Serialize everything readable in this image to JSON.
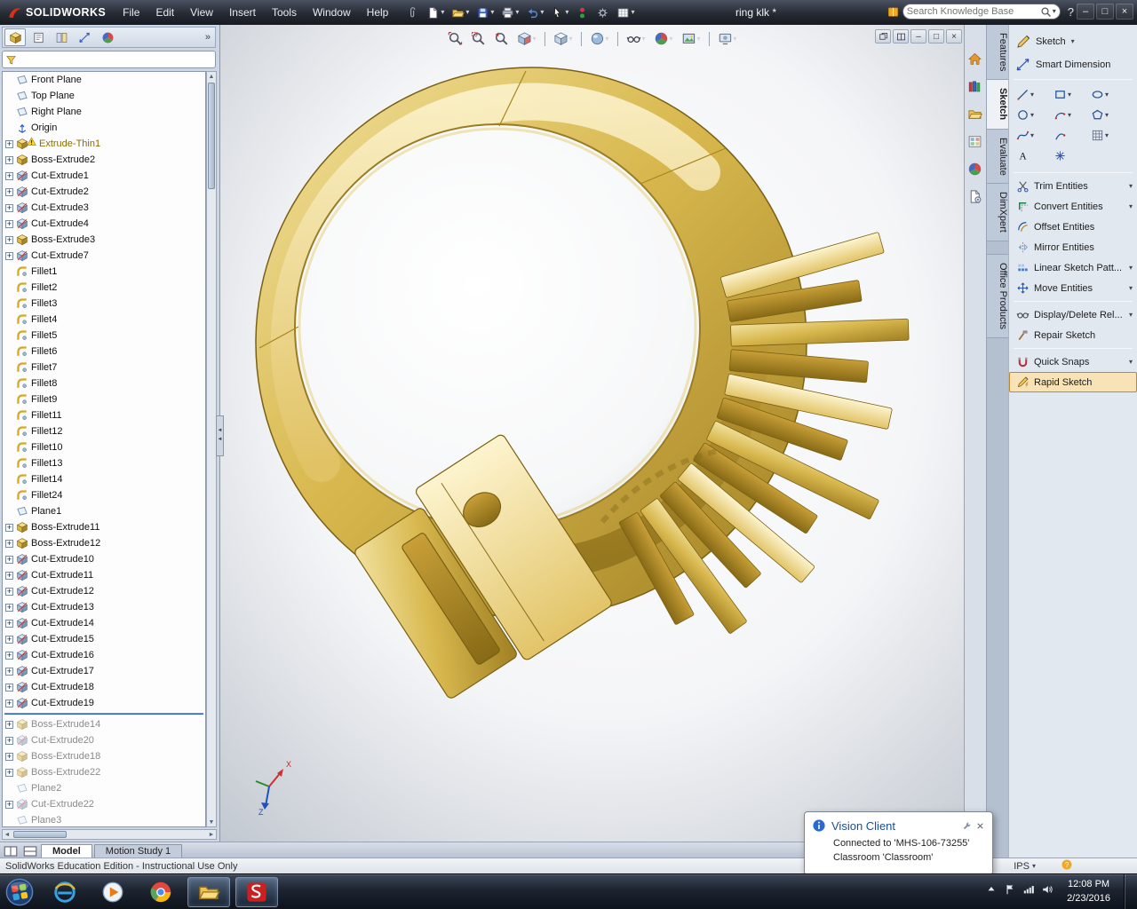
{
  "title_bar": {
    "app_name": "SOLIDWORKS",
    "menus": [
      "File",
      "Edit",
      "View",
      "Insert",
      "Tools",
      "Window",
      "Help"
    ],
    "toolbar": [
      {
        "name": "attach",
        "caret": false
      },
      {
        "name": "new-document",
        "caret": true
      },
      {
        "name": "open",
        "caret": true
      },
      {
        "name": "save",
        "caret": true
      },
      {
        "name": "print",
        "caret": true
      },
      {
        "name": "undo",
        "caret": true
      },
      {
        "name": "select",
        "caret": true
      },
      {
        "name": "stoplight",
        "caret": false
      },
      {
        "name": "options",
        "caret": false
      },
      {
        "name": "sheet",
        "caret": true
      }
    ],
    "document_name": "ring klk *",
    "search_placeholder": "Search Knowledge Base",
    "help_glyph": "?",
    "window_buttons": [
      {
        "name": "minimize",
        "glyph": "–"
      },
      {
        "name": "restore",
        "glyph": "□"
      },
      {
        "name": "close",
        "glyph": "×"
      }
    ]
  },
  "feature_manager": {
    "tabs": [
      "featuremanager",
      "propertymanager",
      "configurationmanager",
      "dimxpertmanager",
      "displaymanager"
    ],
    "overflow_glyph": "»",
    "filter_placeholder": ""
  },
  "feature_tree": {
    "items": [
      {
        "label": "Front Plane",
        "icon": "plane"
      },
      {
        "label": "Top Plane",
        "icon": "plane"
      },
      {
        "label": "Right Plane",
        "icon": "plane"
      },
      {
        "label": "Origin",
        "icon": "origin"
      },
      {
        "label": "Extrude-Thin1",
        "icon": "boss",
        "plus": true,
        "state": "warning"
      },
      {
        "label": "Boss-Extrude2",
        "icon": "boss",
        "plus": true
      },
      {
        "label": "Cut-Extrude1",
        "icon": "cut",
        "plus": true
      },
      {
        "label": "Cut-Extrude2",
        "icon": "cut",
        "plus": true
      },
      {
        "label": "Cut-Extrude3",
        "icon": "cut",
        "plus": true
      },
      {
        "label": "Cut-Extrude4",
        "icon": "cut",
        "plus": true
      },
      {
        "label": "Boss-Extrude3",
        "icon": "boss",
        "plus": true
      },
      {
        "label": "Cut-Extrude7",
        "icon": "cut",
        "plus": true
      },
      {
        "label": "Fillet1",
        "icon": "fillet"
      },
      {
        "label": "Fillet2",
        "icon": "fillet"
      },
      {
        "label": "Fillet3",
        "icon": "fillet"
      },
      {
        "label": "Fillet4",
        "icon": "fillet"
      },
      {
        "label": "Fillet5",
        "icon": "fillet"
      },
      {
        "label": "Fillet6",
        "icon": "fillet"
      },
      {
        "label": "Fillet7",
        "icon": "fillet"
      },
      {
        "label": "Fillet8",
        "icon": "fillet"
      },
      {
        "label": "Fillet9",
        "icon": "fillet"
      },
      {
        "label": "Fillet11",
        "icon": "fillet"
      },
      {
        "label": "Fillet12",
        "icon": "fillet"
      },
      {
        "label": "Fillet10",
        "icon": "fillet"
      },
      {
        "label": "Fillet13",
        "icon": "fillet"
      },
      {
        "label": "Fillet14",
        "icon": "fillet"
      },
      {
        "label": "Fillet24",
        "icon": "fillet"
      },
      {
        "label": "Plane1",
        "icon": "plane"
      },
      {
        "label": "Boss-Extrude11",
        "icon": "boss",
        "plus": true
      },
      {
        "label": "Boss-Extrude12",
        "icon": "boss",
        "plus": true
      },
      {
        "label": "Cut-Extrude10",
        "icon": "cut",
        "plus": true
      },
      {
        "label": "Cut-Extrude11",
        "icon": "cut",
        "plus": true
      },
      {
        "label": "Cut-Extrude12",
        "icon": "cut",
        "plus": true
      },
      {
        "label": "Cut-Extrude13",
        "icon": "cut",
        "plus": true
      },
      {
        "label": "Cut-Extrude14",
        "icon": "cut",
        "plus": true
      },
      {
        "label": "Cut-Extrude15",
        "icon": "cut",
        "plus": true
      },
      {
        "label": "Cut-Extrude16",
        "icon": "cut",
        "plus": true
      },
      {
        "label": "Cut-Extrude17",
        "icon": "cut",
        "plus": true
      },
      {
        "label": "Cut-Extrude18",
        "icon": "cut",
        "plus": true
      },
      {
        "label": "Cut-Extrude19",
        "icon": "cut",
        "plus": true
      },
      {
        "type": "rollback"
      },
      {
        "label": "Boss-Extrude14",
        "icon": "boss",
        "plus": true,
        "state": "grayed"
      },
      {
        "label": "Cut-Extrude20",
        "icon": "cut",
        "plus": true,
        "state": "grayed"
      },
      {
        "label": "Boss-Extrude18",
        "icon": "boss",
        "plus": true,
        "state": "grayed"
      },
      {
        "label": "Boss-Extrude22",
        "icon": "boss",
        "plus": true,
        "state": "grayed"
      },
      {
        "label": "Plane2",
        "icon": "plane",
        "state": "grayed"
      },
      {
        "label": "Cut-Extrude22",
        "icon": "cut",
        "plus": true,
        "state": "grayed"
      },
      {
        "label": "Plane3",
        "icon": "plane",
        "state": "grayed"
      }
    ]
  },
  "viewport": {
    "toolbar": [
      {
        "name": "zoom-fit"
      },
      {
        "name": "zoom-area"
      },
      {
        "name": "zoom-previous"
      },
      {
        "name": "section-view",
        "caret": true
      },
      {
        "sep": true
      },
      {
        "name": "view-orientation",
        "caret": true
      },
      {
        "sep": true
      },
      {
        "name": "display-style",
        "caret": true
      },
      {
        "sep": true
      },
      {
        "name": "hide-show-items",
        "caret": true
      },
      {
        "name": "edit-appearance",
        "caret": true
      },
      {
        "name": "apply-scene",
        "caret": true
      },
      {
        "sep": true
      },
      {
        "name": "view-settings",
        "caret": true
      }
    ],
    "window_buttons": [
      {
        "name": "new-window"
      },
      {
        "name": "split-window"
      },
      {
        "name": "minimize-document",
        "glyph": "–"
      },
      {
        "name": "restore-document",
        "glyph": "□"
      },
      {
        "name": "close-document",
        "glyph": "×"
      }
    ],
    "triad": {
      "x": "X",
      "z": "Z"
    }
  },
  "task_pane": {
    "icons": [
      "solidworks-resources",
      "design-library",
      "file-explorer",
      "view-palette",
      "appearances",
      "custom-properties"
    ]
  },
  "command_tabs": [
    {
      "label": "Features",
      "active": false
    },
    {
      "label": "Sketch",
      "active": true
    },
    {
      "label": "Evaluate",
      "active": false
    },
    {
      "label": "DimXpert",
      "active": false
    },
    {
      "label": "Office Products",
      "active": false
    }
  ],
  "sketch_panel": {
    "primary": [
      {
        "icon": "sketch-pencil",
        "label": "Sketch",
        "caret": true
      },
      {
        "icon": "smart-dimension",
        "label": "Smart Dimension",
        "caret": false
      }
    ],
    "entity_grid": [
      {
        "icon": "line",
        "caret": true
      },
      {
        "icon": "rectangle",
        "caret": true
      },
      {
        "icon": "ellipse",
        "caret": true
      },
      {
        "icon": "circle",
        "caret": true
      },
      {
        "icon": "arc",
        "caret": true
      },
      {
        "icon": "polygon",
        "caret": true
      },
      {
        "icon": "spline",
        "caret": true
      },
      {
        "icon": "curve",
        "caret": false
      },
      {
        "icon": "grid",
        "caret": true
      },
      {
        "icon": "text",
        "caret": false
      },
      {
        "icon": "point",
        "caret": false
      }
    ],
    "tools": [
      {
        "icon": "trim",
        "label": "Trim Entities",
        "caret": true
      },
      {
        "icon": "convert",
        "label": "Convert Entities",
        "caret": true
      },
      {
        "icon": "offset",
        "label": "Offset Entities",
        "caret": false
      },
      {
        "icon": "mirror",
        "label": "Mirror Entities",
        "caret": false
      },
      {
        "icon": "linear-pattern",
        "label": "Linear Sketch Patt...",
        "caret": true
      },
      {
        "icon": "move",
        "label": "Move Entities",
        "caret": true
      },
      {
        "icon": "display-relations",
        "label": "Display/Delete Rel...",
        "caret": true,
        "divider_before": true
      },
      {
        "icon": "repair",
        "label": "Repair Sketch",
        "caret": false
      },
      {
        "icon": "quick-snaps",
        "label": "Quick Snaps",
        "caret": true,
        "divider_before": true
      },
      {
        "icon": "rapid-sketch",
        "label": "Rapid Sketch",
        "caret": false,
        "selected": true
      }
    ]
  },
  "doc_bar": {
    "tabs": [
      {
        "label": "Model",
        "active": true
      },
      {
        "label": "Motion Study 1",
        "active": false
      }
    ]
  },
  "status_bar": {
    "text": "SolidWorks Education Edition - Instructional Use Only",
    "units": "IPS"
  },
  "notification": {
    "title": "Vision Client",
    "lines": [
      "Connected to 'MHS-106-73255'",
      "Classroom 'Classroom'"
    ]
  },
  "taskbar": {
    "buttons": [
      {
        "name": "internet-explorer"
      },
      {
        "name": "media-player"
      },
      {
        "name": "chrome"
      },
      {
        "name": "windows-explorer",
        "open": true
      },
      {
        "name": "solidworks",
        "open": true
      }
    ],
    "tray": [
      "show-hidden",
      "action-center",
      "network",
      "volume"
    ],
    "clock": {
      "time": "12:08 PM",
      "date": "2/23/2016"
    }
  }
}
